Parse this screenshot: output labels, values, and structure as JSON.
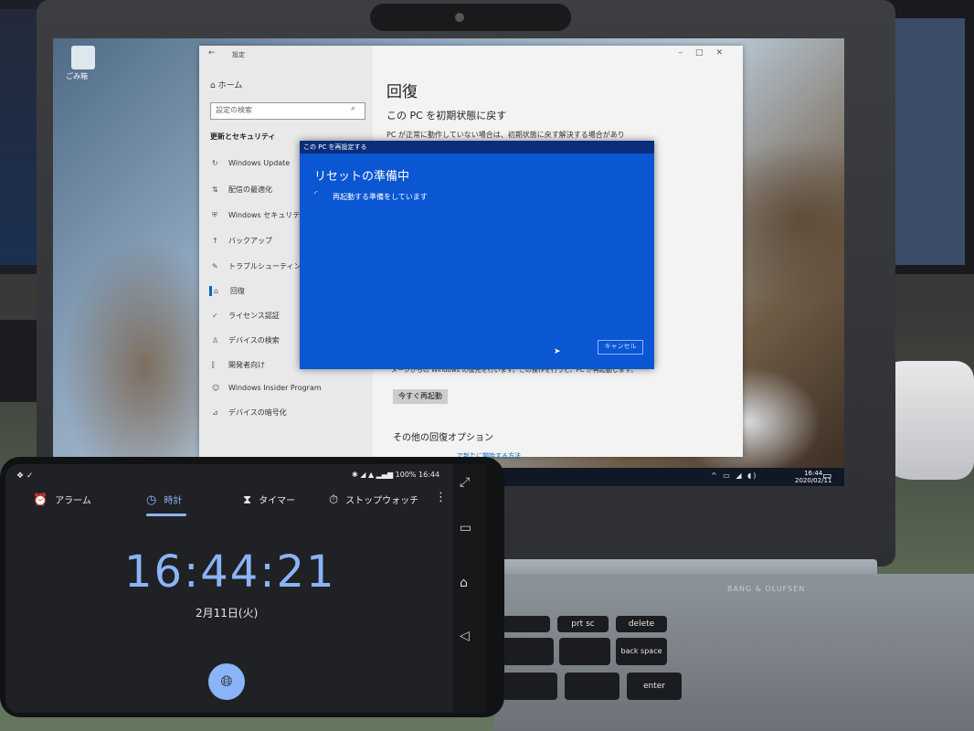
{
  "desktop": {
    "recycle_bin_label": "ごみ箱"
  },
  "settings": {
    "window_title": "設定",
    "home_label": "ホーム",
    "search_placeholder": "設定の検索",
    "section_heading": "更新とセキュリティ",
    "nav_items": [
      {
        "icon": "refresh-icon",
        "label": "Windows Update"
      },
      {
        "icon": "delivery-icon",
        "label": "配信の最適化"
      },
      {
        "icon": "shield-icon",
        "label": "Windows セキュリティ"
      },
      {
        "icon": "backup-icon",
        "label": "バックアップ"
      },
      {
        "icon": "wrench-icon",
        "label": "トラブルシューティング"
      },
      {
        "icon": "recovery-icon",
        "label": "回復"
      },
      {
        "icon": "check-circle-icon",
        "label": "ライセンス認証"
      },
      {
        "icon": "person-pin-icon",
        "label": "デバイスの検索"
      },
      {
        "icon": "dev-tools-icon",
        "label": "開発者向け"
      },
      {
        "icon": "insider-icon",
        "label": "Windows Insider Program"
      },
      {
        "icon": "encryption-icon",
        "label": "デバイスの暗号化"
      }
    ],
    "page_title": "回復",
    "page_subtitle": "この PC を初期状態に戻す",
    "page_body": "PC が正常に動作していない場合は、初期状態に戻す解決する場合があり",
    "restart_note": "メージからの Windows の復元を行います。この操作を行うと、PC が再起動します。",
    "restart_button": "今すぐ再起動",
    "other_options_heading": "その他の回復オプション",
    "other_options_link": "で新たに開始する方法"
  },
  "reset_dialog": {
    "title": "この PC を再設定する",
    "heading": "リセットの準備中",
    "status": "再起動する準備をしています",
    "cancel_label": "キャンセル"
  },
  "taskbar": {
    "time": "16:44",
    "date": "2020/02/11"
  },
  "laptop": {
    "brand": "BANG & OLUFSEN",
    "keys": [
      "prt sc",
      "delete",
      "back space",
      "enter"
    ]
  },
  "phone": {
    "status_right": "100% 16:44",
    "tabs": [
      {
        "icon": "alarm-icon",
        "label": "アラーム",
        "active": false
      },
      {
        "icon": "clock-icon",
        "label": "時計",
        "active": true
      },
      {
        "icon": "hourglass-icon",
        "label": "タイマー",
        "active": false
      },
      {
        "icon": "stopwatch-icon",
        "label": "ストップウォッチ",
        "active": false
      }
    ],
    "time": "16:44:21",
    "date": "2月11日(火)"
  },
  "colors": {
    "dialog_blue": "#0a56d3",
    "clock_accent": "#8ab4f8",
    "windows_accent": "#0067c0"
  }
}
